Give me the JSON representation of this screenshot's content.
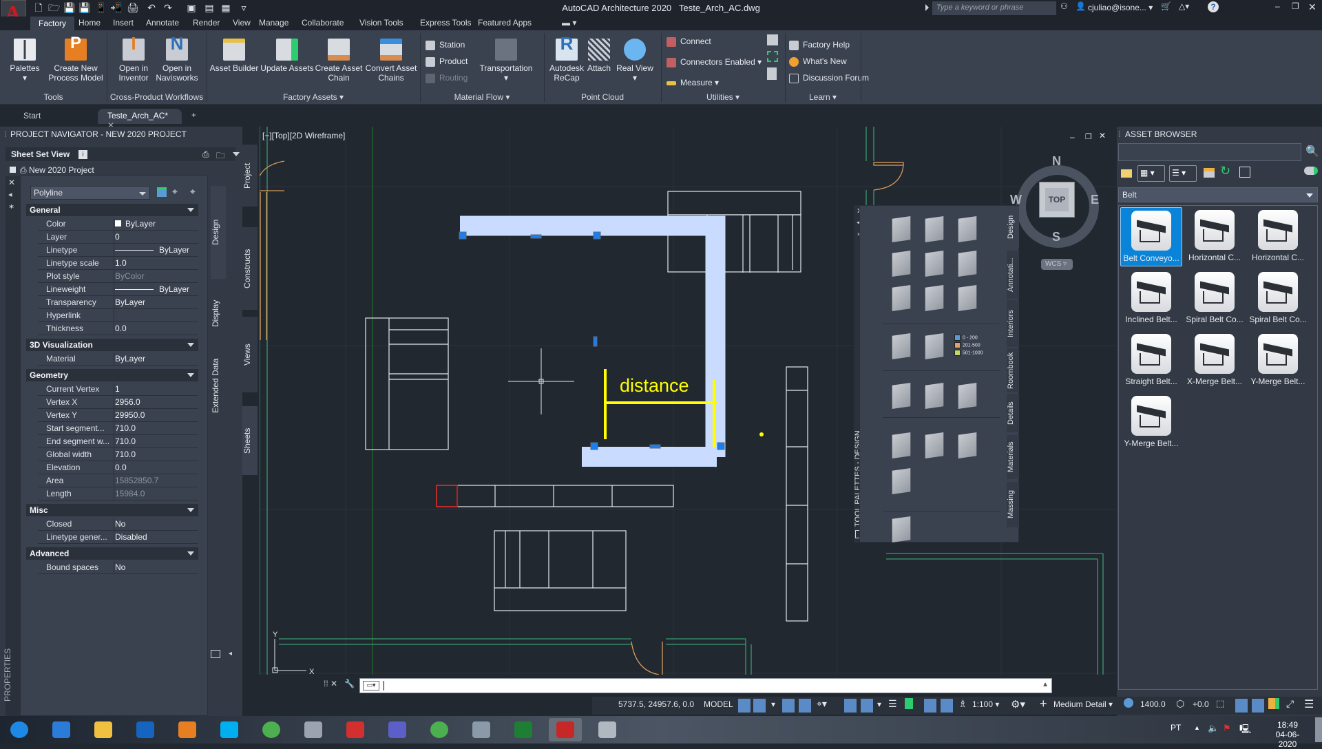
{
  "app": {
    "title": "AutoCAD Architecture 2020",
    "filename": "Teste_Arch_AC.dwg",
    "search_placeholder": "Type a keyword or phrase",
    "user": "cjuliao@isone...",
    "window_controls": [
      "minimize",
      "restore",
      "close"
    ]
  },
  "quick_access": [
    "new-icon",
    "open-icon",
    "save-icon",
    "save-as-icon",
    "open-from-mobile-icon",
    "save-to-mobile-icon",
    "plot-icon",
    "undo-icon",
    "redo-icon",
    "workspace-icon",
    "sheet-icon",
    "layout-icon",
    "customize-icon"
  ],
  "ribbon_tabs": [
    "Factory",
    "Home",
    "Insert",
    "Annotate",
    "Render",
    "View",
    "Manage",
    "Collaborate",
    "Vision Tools",
    "Express Tools",
    "Featured Apps"
  ],
  "active_tab": "Factory",
  "ribbon_panels": {
    "tools": {
      "label": "Tools",
      "buttons": [
        {
          "label": "Palettes",
          "icon": "palettes-icon"
        },
        {
          "label": "Create New Process Model",
          "icon": "process-model-icon"
        }
      ]
    },
    "cross": {
      "label": "Cross-Product Workflows",
      "buttons": [
        {
          "label": "Open in Inventor",
          "icon": "inventor-icon"
        },
        {
          "label": "Open in Navisworks",
          "icon": "navisworks-icon"
        }
      ]
    },
    "factory_assets": {
      "label": "Factory Assets",
      "buttons": [
        {
          "label": "Asset Builder",
          "icon": "asset-builder-icon"
        },
        {
          "label": "Update Assets",
          "icon": "update-assets-icon"
        },
        {
          "label": "Create Asset Chain",
          "icon": "create-chain-icon"
        },
        {
          "label": "Convert Asset Chains",
          "icon": "convert-chain-icon"
        }
      ]
    },
    "material_flow": {
      "label": "Material Flow",
      "small": [
        "Station",
        "Product",
        "Routing"
      ],
      "large": "Transportation"
    },
    "point_cloud": {
      "label": "Point Cloud",
      "buttons": [
        {
          "label": "Autodesk ReCap",
          "icon": "recap-icon"
        },
        {
          "label": "Attach",
          "icon": "attach-icon"
        },
        {
          "label": "Real View",
          "icon": "real-view-icon"
        }
      ]
    },
    "utilities": {
      "label": "Utilities",
      "small": [
        "Connect",
        "Connectors Enabled",
        "Measure"
      ]
    },
    "learn": {
      "label": "Learn",
      "small": [
        "Factory Help",
        "What's New",
        "Discussion Forum"
      ]
    }
  },
  "doc_tabs": [
    "Start",
    "Teste_Arch_AC*"
  ],
  "project_navigator": {
    "title": "PROJECT NAVIGATOR - NEW 2020 PROJECT",
    "sheet_set_view": "Sheet Set View",
    "project": "New 2020 Project",
    "side_tabs": [
      "Project",
      "Constructs",
      "Views",
      "Sheets"
    ]
  },
  "properties": {
    "object_type": "Polyline",
    "side_tabs": [
      "Design",
      "Display",
      "Extended Data"
    ],
    "panel_label": "PROPERTIES",
    "groups": [
      {
        "name": "General",
        "rows": [
          {
            "k": "Color",
            "v": "ByLayer",
            "swatch": "#ffffff"
          },
          {
            "k": "Layer",
            "v": "0"
          },
          {
            "k": "Linetype",
            "v": "ByLayer",
            "line": true
          },
          {
            "k": "Linetype scale",
            "v": "1.0"
          },
          {
            "k": "Plot style",
            "v": "ByColor",
            "dim": true
          },
          {
            "k": "Lineweight",
            "v": "ByLayer",
            "line": true
          },
          {
            "k": "Transparency",
            "v": "ByLayer"
          },
          {
            "k": "Hyperlink",
            "v": ""
          },
          {
            "k": "Thickness",
            "v": "0.0"
          }
        ]
      },
      {
        "name": "3D Visualization",
        "rows": [
          {
            "k": "Material",
            "v": "ByLayer"
          }
        ]
      },
      {
        "name": "Geometry",
        "rows": [
          {
            "k": "Current Vertex",
            "v": "1"
          },
          {
            "k": "Vertex X",
            "v": "2956.0"
          },
          {
            "k": "Vertex Y",
            "v": "29950.0"
          },
          {
            "k": "Start segment...",
            "v": "710.0"
          },
          {
            "k": "End segment w...",
            "v": "710.0"
          },
          {
            "k": "Global width",
            "v": "710.0"
          },
          {
            "k": "Elevation",
            "v": "0.0"
          },
          {
            "k": "Area",
            "v": "15852850.7",
            "dim": true
          },
          {
            "k": "Length",
            "v": "15984.0",
            "dim": true
          }
        ]
      },
      {
        "name": "Misc",
        "rows": [
          {
            "k": "Closed",
            "v": "No"
          },
          {
            "k": "Linetype gener...",
            "v": "Disabled"
          }
        ]
      },
      {
        "name": "Advanced",
        "rows": [
          {
            "k": "Bound spaces",
            "v": "No"
          }
        ]
      }
    ]
  },
  "viewport": {
    "caption": "[−][Top][2D Wireframe]",
    "annotation": "distance",
    "viewcube": {
      "face": "TOP",
      "n": "N",
      "s": "S",
      "e": "E",
      "w": "W",
      "ucs": "WCS"
    }
  },
  "tool_palette": {
    "title": "TOOL PALETTES - DESIGN",
    "tabs": [
      "Design",
      "Annotati...",
      "Interiors",
      "Roombook",
      "Details",
      "Materials",
      "Massing"
    ],
    "legend": [
      "0 - 200",
      "201-500",
      "501-1000"
    ],
    "legend_colors": [
      "#5b9bd5",
      "#e0a070",
      "#c6d860"
    ]
  },
  "asset_browser": {
    "title": "ASSET BROWSER",
    "category": "Belt",
    "items": [
      "Belt Conveyo...",
      "Horizontal C...",
      "Horizontal C...",
      "Inclined Belt...",
      "Spiral Belt Co...",
      "Spiral Belt Co...",
      "Straight Belt...",
      "X-Merge Belt...",
      "Y-Merge Belt...",
      "Y-Merge Belt..."
    ],
    "selected_index": 0
  },
  "status": {
    "coords": "5737.5, 24957.6, 0.0",
    "space": "MODEL",
    "scale": "1:100",
    "detail": "Medium Detail",
    "elevation": "1400.0",
    "offset": "+0.0"
  },
  "taskbar": {
    "apps": [
      "windows-start",
      "internet-explorer",
      "file-explorer",
      "outlook",
      "inventor",
      "skype",
      "chrome",
      "calculator",
      "acrobat",
      "teams",
      "chrome",
      "aquasnap",
      "excel",
      "autocad",
      "paint"
    ],
    "lang": "PT",
    "time": "18:49",
    "date": "04-06-2020"
  }
}
